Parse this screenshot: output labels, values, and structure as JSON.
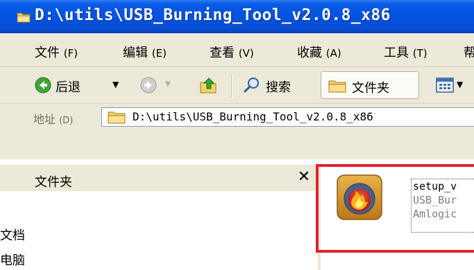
{
  "window": {
    "title": "D:\\utils\\USB_Burning_Tool_v2.0.8_x86",
    "title_icon": "folder-icon"
  },
  "menu": {
    "items": [
      {
        "label": "文件",
        "accel": "(F)"
      },
      {
        "label": "编辑",
        "accel": "(E)"
      },
      {
        "label": "查看",
        "accel": "(V)"
      },
      {
        "label": "收藏",
        "accel": "(A)"
      },
      {
        "label": "工具",
        "accel": "(T)"
      },
      {
        "label": "帮",
        "accel": ""
      }
    ]
  },
  "toolbar": {
    "back_label": "后退",
    "search_label": "搜索",
    "folders_label": "文件夹",
    "icons": [
      "back-icon",
      "forward-icon",
      "up-folder-icon",
      "search-icon",
      "folders-icon",
      "views-icon"
    ]
  },
  "address": {
    "label": "地址",
    "accel": "(D)",
    "value": "D:\\utils\\USB_Burning_Tool_v2.0.8_x86"
  },
  "folders_pane": {
    "title": "文件夹",
    "close": "✕",
    "items": [
      "文档",
      "电脑"
    ]
  },
  "file": {
    "name": "setup_v",
    "line2": "USB_Bur",
    "line3": "Amlogic"
  },
  "colors": {
    "titlebar": "#0052e0",
    "chrome": "#ece9d8",
    "highlight": "#e0232a"
  }
}
